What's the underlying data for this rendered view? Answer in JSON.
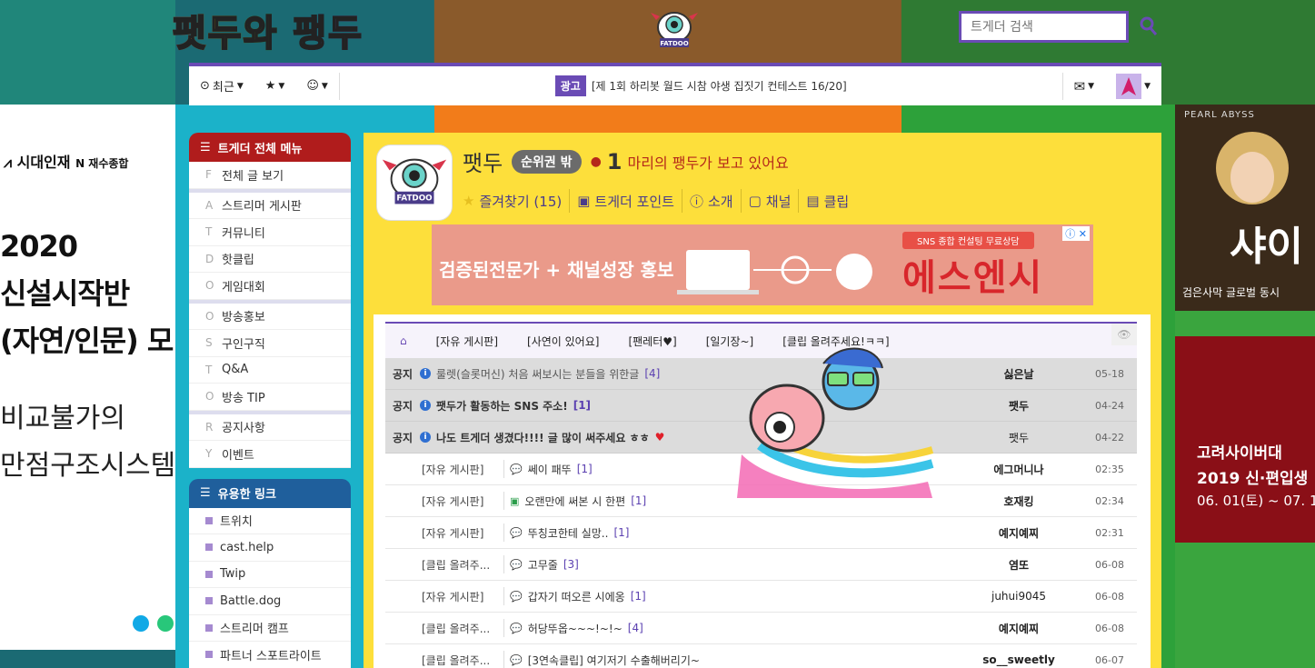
{
  "site": {
    "logo_text": "팻두와 팽두"
  },
  "search": {
    "placeholder": "트게더 검색"
  },
  "topbar": {
    "recent_label": "최근",
    "ad_badge": "광고",
    "ad_text": "[제 1회 하리봇 월드 시참 야생 집짓기 컨테스트 16/20]"
  },
  "left_ad": {
    "brand": "시대인재",
    "brand_suffix": "N 재수종합",
    "line1": "2020",
    "line2": "신설시작반",
    "line3": "(자연/인문) 모",
    "line4": "비교불가의",
    "line5": "만점구조시스템"
  },
  "sidebar": {
    "menu_title": "트게더 전체 메뉴",
    "groups": [
      [
        {
          "letter": "F",
          "label": "전체 글 보기"
        }
      ],
      [
        {
          "letter": "A",
          "label": "스트리머 게시판"
        },
        {
          "letter": "T",
          "label": "커뮤니티"
        },
        {
          "letter": "D",
          "label": "핫클립"
        },
        {
          "letter": "O",
          "label": "게임대회"
        }
      ],
      [
        {
          "letter": "O",
          "label": "방송홍보"
        },
        {
          "letter": "S",
          "label": "구인구직"
        },
        {
          "letter": "T",
          "label": "Q&A"
        },
        {
          "letter": "O",
          "label": "방송 TIP"
        }
      ],
      [
        {
          "letter": "R",
          "label": "공지사항"
        },
        {
          "letter": "Y",
          "label": "이벤트"
        }
      ]
    ],
    "links_title": "유용한 링크",
    "links": [
      "트위치",
      "cast.help",
      "Twip",
      "Battle.dog",
      "스트리머 캠프",
      "파트너 스포트라이트"
    ]
  },
  "profile": {
    "name": "팻두",
    "rank": "순위권 밖",
    "viewer_count": "1",
    "viewer_text": "마리의 팽두가 보고 있어요",
    "links": [
      "즐겨찾기 (15)",
      "트게더 포인트",
      "소개",
      "채널",
      "클립"
    ]
  },
  "banner": {
    "left_text": "검증된전문가 + 채널성장 홍보",
    "tag": "SNS 종합 컨설팅 무료상담",
    "brand": "에스엔시"
  },
  "board": {
    "tabs": [
      "[자유 게시판]",
      "[사연이 있어요]",
      "[팬레터♥]",
      "[일기장~]",
      "[클립 올려주세요!ㅋㅋ]"
    ],
    "notices": [
      {
        "tag": "공지",
        "title": "룰렛(슬롯머신) 처음 써보시는 분들을 위한글",
        "count": "[4]",
        "author": "싫은날",
        "date": "05-18"
      },
      {
        "tag": "공지",
        "title": "팻두가 활동하는 SNS 주소!",
        "count": "[1]",
        "author": "팻두",
        "date": "04-24"
      },
      {
        "tag": "공지",
        "title": "나도 트게더 생겼다!!!! 글 많이 써주세요 ㅎㅎ",
        "count": "",
        "author": "팻두",
        "date": "04-22"
      }
    ],
    "posts": [
      {
        "category": "[자유 게시판]",
        "title": "쎄이 패뚜",
        "count": "[1]",
        "author": "에그머니나",
        "date": "02:35"
      },
      {
        "category": "[자유 게시판]",
        "title": "오랜만에 써본 시 한편",
        "count": "[1]",
        "author": "호재킹",
        "date": "02:34"
      },
      {
        "category": "[자유 게시판]",
        "title": "뚜칭코한테 실망..",
        "count": "[1]",
        "author": "예지예찌",
        "date": "02:31"
      },
      {
        "category": "[클립 올려주...",
        "title": "고무줄",
        "count": "[3]",
        "author": "염또",
        "date": "06-08"
      },
      {
        "category": "[자유 게시판]",
        "title": "갑자기 떠오른 시에옹",
        "count": "[1]",
        "author": "juhui9045",
        "date": "06-08"
      },
      {
        "category": "[클립 올려주...",
        "title": "허당뚜옵~~~!~!~",
        "count": "[4]",
        "author": "예지예찌",
        "date": "06-08"
      },
      {
        "category": "[클립 올려주...",
        "title": "[3연속클립] 여기저기 수출해버리기~",
        "count": "",
        "author": "so__sweetly",
        "date": "06-07"
      }
    ]
  },
  "right_ads": {
    "ad1_brand": "PEARL ABYSS",
    "ad1_title": "샤이",
    "ad1_sub": "검은사막 글로벌 동시",
    "ad2_line1": "고려사이버대",
    "ad2_line2": "2019 신·편입생",
    "ad2_line3": "06. 01(토) ~ 07. 1"
  },
  "colors": {
    "accent": "#6a4bb5",
    "panel": "#fddf3b",
    "menu_red": "#b01c1c",
    "menu_blue": "#1f5f9c"
  }
}
